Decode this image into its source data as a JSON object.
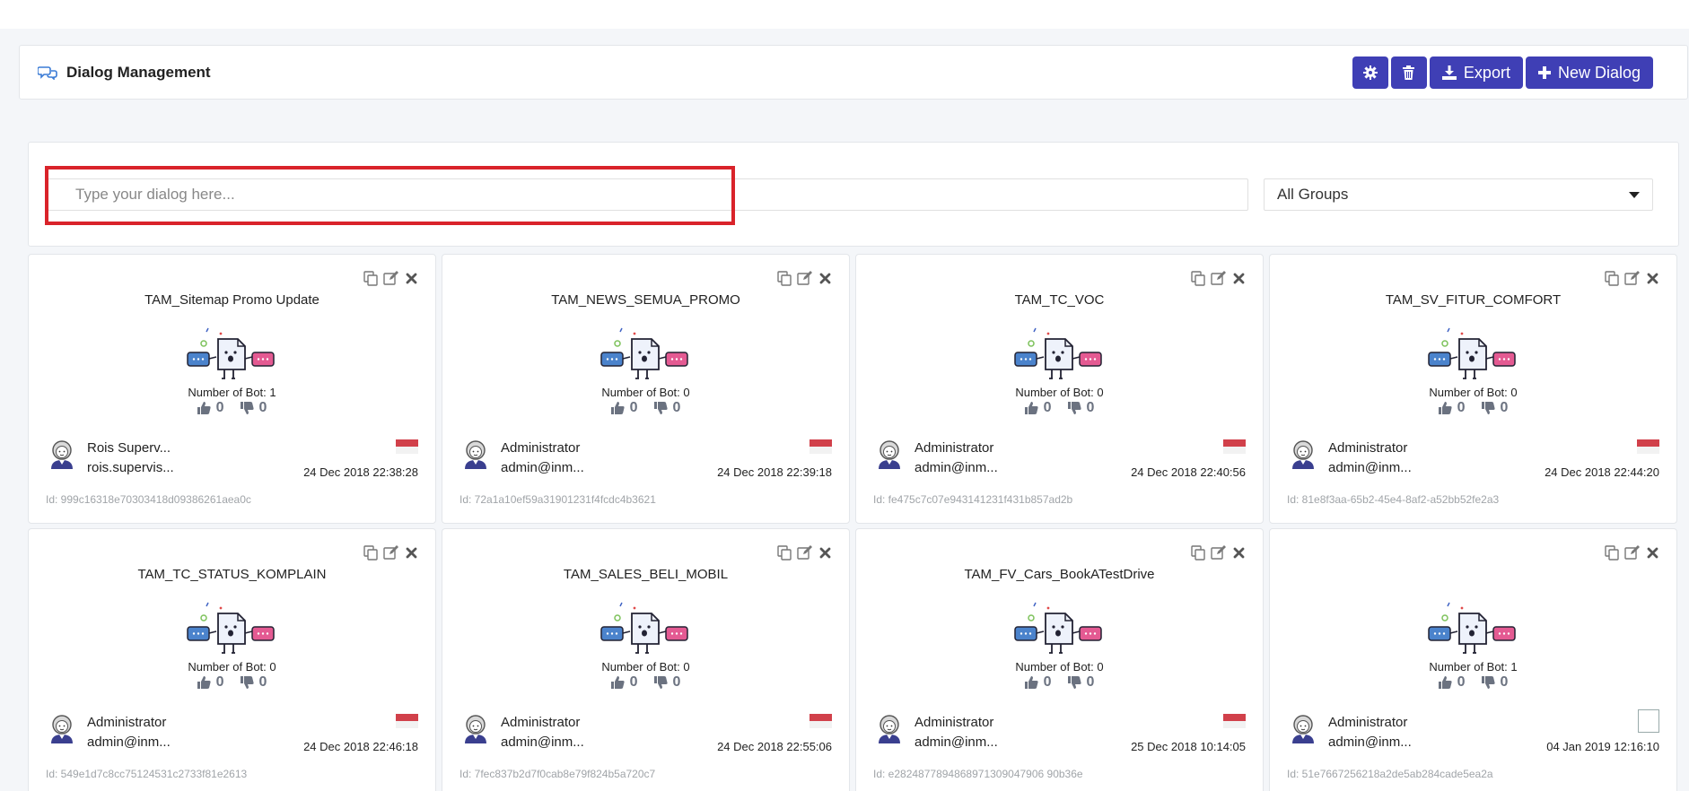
{
  "header": {
    "title": "Dialog Management",
    "export_label": "Export",
    "new_dialog_label": "New Dialog"
  },
  "search": {
    "placeholder": "Type your dialog here...",
    "group_selected": "All Groups"
  },
  "colors": {
    "primary": "#3f3fb5",
    "highlight": "#d9232a",
    "flag_red": "#d1404a"
  },
  "cards": [
    {
      "title": "TAM_Sitemap Promo Update",
      "bots": "Number of Bot: 1",
      "likes": "0",
      "dislikes": "0",
      "user": "Rois Superv...",
      "email": "rois.supervis...",
      "date": "24 Dec 2018 22:38:28",
      "id": "Id: 999c16318e70303418d09386261aea0c",
      "flag": "id-flag"
    },
    {
      "title": "TAM_NEWS_SEMUA_PROMO",
      "bots": "Number of Bot: 0",
      "likes": "0",
      "dislikes": "0",
      "user": "Administrator",
      "email": "admin@inm...",
      "date": "24 Dec 2018 22:39:18",
      "id": "Id: 72a1a10ef59a31901231f4fcdc4b3621",
      "flag": "id-flag"
    },
    {
      "title": "TAM_TC_VOC",
      "bots": "Number of Bot: 0",
      "likes": "0",
      "dislikes": "0",
      "user": "Administrator",
      "email": "admin@inm...",
      "date": "24 Dec 2018 22:40:56",
      "id": "Id: fe475c7c07e943141231f431b857ad2b",
      "flag": "id-flag"
    },
    {
      "title": "TAM_SV_FITUR_COMFORT",
      "bots": "Number of Bot: 0",
      "likes": "0",
      "dislikes": "0",
      "user": "Administrator",
      "email": "admin@inm...",
      "date": "24 Dec 2018 22:44:20",
      "id": "Id: 81e8f3aa-65b2-45e4-8af2-a52bb52fe2a3",
      "flag": "id-flag"
    },
    {
      "title": "TAM_TC_STATUS_KOMPLAIN",
      "bots": "Number of Bot: 0",
      "likes": "0",
      "dislikes": "0",
      "user": "Administrator",
      "email": "admin@inm...",
      "date": "24 Dec 2018 22:46:18",
      "id": "Id: 549e1d7c8cc75124531c2733f81e2613",
      "flag": "id-flag"
    },
    {
      "title": "TAM_SALES_BELI_MOBIL",
      "bots": "Number of Bot: 0",
      "likes": "0",
      "dislikes": "0",
      "user": "Administrator",
      "email": "admin@inm...",
      "date": "24 Dec 2018 22:55:06",
      "id": "Id: 7fec837b2d7f0cab8e79f824b5a720c7",
      "flag": "id-flag"
    },
    {
      "title": "TAM_FV_Cars_BookATestDrive",
      "bots": "Number of Bot: 0",
      "likes": "0",
      "dislikes": "0",
      "user": "Administrator",
      "email": "admin@inm...",
      "date": "25 Dec 2018 10:14:05",
      "id": "Id: e2824877894868971309047906 90b36e",
      "flag": "id-flag"
    },
    {
      "title": "",
      "bots": "Number of Bot: 1",
      "likes": "0",
      "dislikes": "0",
      "user": "Administrator",
      "email": "admin@inm...",
      "date": "04 Jan 2019 12:16:10",
      "id": "Id: 51e7667256218a2de5ab284cade5ea2a",
      "flag": "broken-image"
    }
  ]
}
